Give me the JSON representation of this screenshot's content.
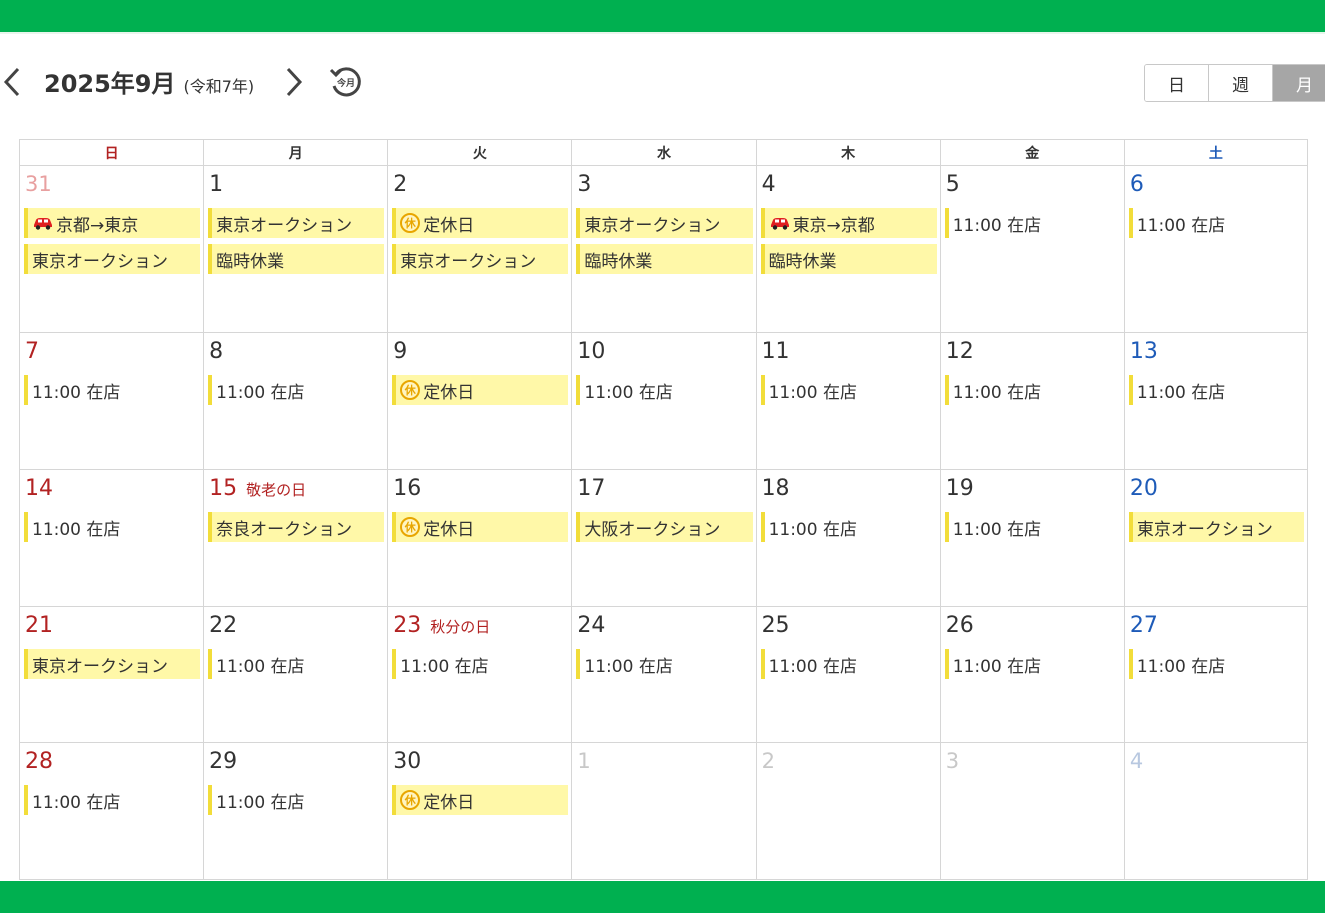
{
  "header": {
    "title": "2025年9月",
    "era": "(令和7年)",
    "today_label": "今月",
    "views": [
      {
        "label": "日",
        "active": false
      },
      {
        "label": "週",
        "active": false
      },
      {
        "label": "月",
        "active": true
      }
    ]
  },
  "weekdays": [
    "日",
    "月",
    "火",
    "水",
    "木",
    "金",
    "土"
  ],
  "colors": {
    "accent_green": "#00b050",
    "event_bar": "#f2dd3a",
    "event_bg": "#fff8a8",
    "sunday": "#b22222",
    "saturday": "#1e5bb8"
  },
  "event_icons": {
    "car": "car-icon",
    "kyu": "holiday-kyu-icon"
  },
  "holiday_icon_text": "休",
  "weeks": [
    {
      "days": [
        {
          "num": "31",
          "other": true,
          "events": [
            {
              "text": "京都→東京",
              "hl": true,
              "icon": "car"
            },
            {
              "text": "東京オークション",
              "hl": true
            }
          ]
        },
        {
          "num": "1",
          "events": [
            {
              "text": "東京オークション",
              "hl": true
            },
            {
              "text": "臨時休業",
              "hl": true
            }
          ]
        },
        {
          "num": "2",
          "events": [
            {
              "text": "定休日",
              "hl": true,
              "icon": "kyu"
            },
            {
              "text": "東京オークション",
              "hl": true
            }
          ]
        },
        {
          "num": "3",
          "events": [
            {
              "text": "東京オークション",
              "hl": true
            },
            {
              "text": "臨時休業",
              "hl": true
            }
          ]
        },
        {
          "num": "4",
          "events": [
            {
              "text": "東京→京都",
              "hl": true,
              "icon": "car"
            },
            {
              "text": "臨時休業",
              "hl": true
            }
          ]
        },
        {
          "num": "5",
          "events": [
            {
              "text": "11:00 在店"
            }
          ]
        },
        {
          "num": "6",
          "events": [
            {
              "text": "11:00 在店"
            }
          ]
        }
      ]
    },
    {
      "days": [
        {
          "num": "7",
          "events": [
            {
              "text": "11:00 在店"
            }
          ]
        },
        {
          "num": "8",
          "events": [
            {
              "text": "11:00 在店"
            }
          ]
        },
        {
          "num": "9",
          "events": [
            {
              "text": "定休日",
              "hl": true,
              "icon": "kyu"
            }
          ]
        },
        {
          "num": "10",
          "events": [
            {
              "text": "11:00 在店"
            }
          ]
        },
        {
          "num": "11",
          "events": [
            {
              "text": "11:00 在店"
            }
          ]
        },
        {
          "num": "12",
          "events": [
            {
              "text": "11:00 在店"
            }
          ]
        },
        {
          "num": "13",
          "events": [
            {
              "text": "11:00 在店"
            }
          ]
        }
      ]
    },
    {
      "days": [
        {
          "num": "14",
          "events": [
            {
              "text": "11:00 在店"
            }
          ]
        },
        {
          "num": "15",
          "holiday": "敬老の日",
          "events": [
            {
              "text": "奈良オークション",
              "hl": true
            }
          ]
        },
        {
          "num": "16",
          "events": [
            {
              "text": "定休日",
              "hl": true,
              "icon": "kyu"
            }
          ]
        },
        {
          "num": "17",
          "events": [
            {
              "text": "大阪オークション",
              "hl": true
            }
          ]
        },
        {
          "num": "18",
          "events": [
            {
              "text": "11:00 在店"
            }
          ]
        },
        {
          "num": "19",
          "events": [
            {
              "text": "11:00 在店"
            }
          ]
        },
        {
          "num": "20",
          "events": [
            {
              "text": "東京オークション",
              "hl": true
            }
          ]
        }
      ]
    },
    {
      "days": [
        {
          "num": "21",
          "events": [
            {
              "text": "東京オークション",
              "hl": true
            }
          ]
        },
        {
          "num": "22",
          "events": [
            {
              "text": "11:00 在店"
            }
          ]
        },
        {
          "num": "23",
          "holiday": "秋分の日",
          "events": [
            {
              "text": "11:00 在店"
            }
          ]
        },
        {
          "num": "24",
          "events": [
            {
              "text": "11:00 在店"
            }
          ]
        },
        {
          "num": "25",
          "events": [
            {
              "text": "11:00 在店"
            }
          ]
        },
        {
          "num": "26",
          "events": [
            {
              "text": "11:00 在店"
            }
          ]
        },
        {
          "num": "27",
          "events": [
            {
              "text": "11:00 在店"
            }
          ]
        }
      ]
    },
    {
      "days": [
        {
          "num": "28",
          "events": [
            {
              "text": "11:00 在店"
            }
          ]
        },
        {
          "num": "29",
          "events": [
            {
              "text": "11:00 在店"
            }
          ]
        },
        {
          "num": "30",
          "events": [
            {
              "text": "定休日",
              "hl": true,
              "icon": "kyu"
            }
          ]
        },
        {
          "num": "1",
          "other": true,
          "events": []
        },
        {
          "num": "2",
          "other": true,
          "events": []
        },
        {
          "num": "3",
          "other": true,
          "events": []
        },
        {
          "num": "4",
          "other": true,
          "events": []
        }
      ]
    }
  ]
}
